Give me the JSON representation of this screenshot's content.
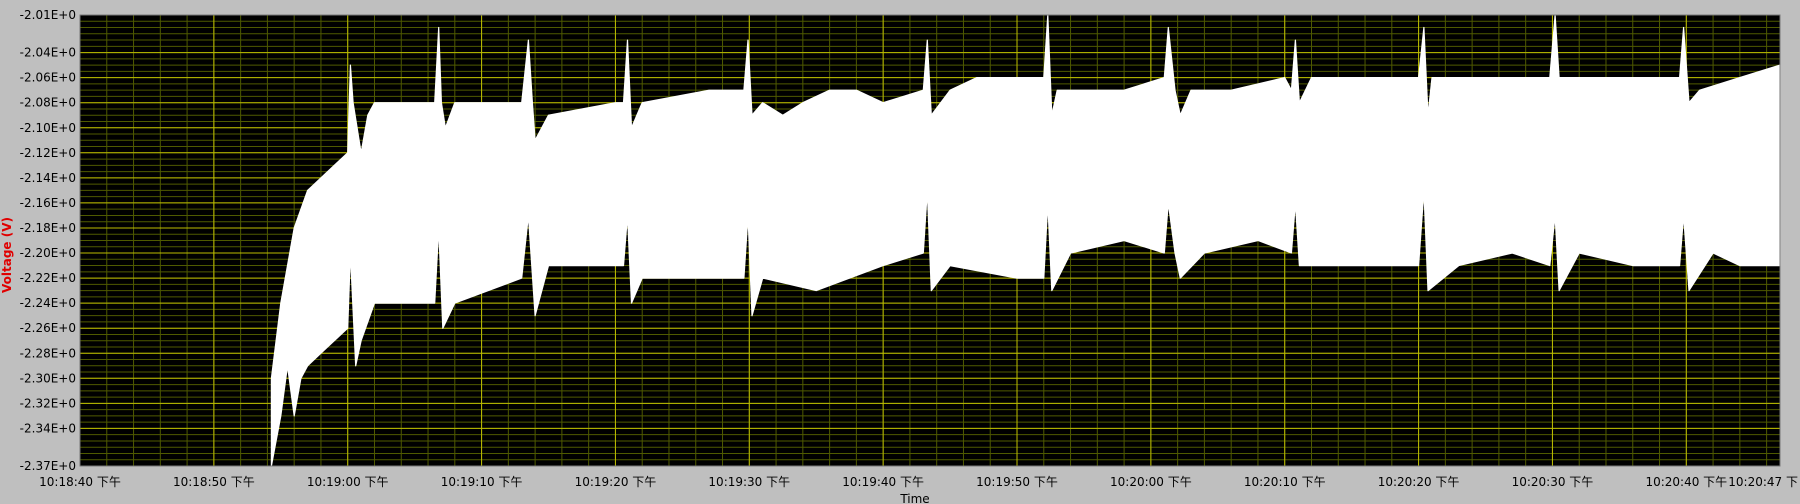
{
  "chart_data": {
    "type": "line",
    "title": "",
    "xlabel": "Time",
    "ylabel": "Voltage (V)",
    "ylim": [
      -2.37,
      -2.01
    ],
    "xlim_seconds": [
      0,
      127
    ],
    "grid": true,
    "background": "#000000",
    "colors": {
      "plot_bg": "#000000",
      "major_grid": "#bdbd00",
      "minor_grid": "#4f5a00",
      "trace": "#ffffff",
      "panel": "#bfbfbf",
      "ylabel": "#e00000"
    },
    "y_ticks": [
      {
        "value": -2.01,
        "label": "-2.01E+0"
      },
      {
        "value": -2.04,
        "label": "-2.04E+0"
      },
      {
        "value": -2.06,
        "label": "-2.06E+0"
      },
      {
        "value": -2.08,
        "label": "-2.08E+0"
      },
      {
        "value": -2.1,
        "label": "-2.10E+0"
      },
      {
        "value": -2.12,
        "label": "-2.12E+0"
      },
      {
        "value": -2.14,
        "label": "-2.14E+0"
      },
      {
        "value": -2.16,
        "label": "-2.16E+0"
      },
      {
        "value": -2.18,
        "label": "-2.18E+0"
      },
      {
        "value": -2.2,
        "label": "-2.20E+0"
      },
      {
        "value": -2.22,
        "label": "-2.22E+0"
      },
      {
        "value": -2.24,
        "label": "-2.24E+0"
      },
      {
        "value": -2.26,
        "label": "-2.26E+0"
      },
      {
        "value": -2.28,
        "label": "-2.28E+0"
      },
      {
        "value": -2.3,
        "label": "-2.30E+0"
      },
      {
        "value": -2.32,
        "label": "-2.32E+0"
      },
      {
        "value": -2.34,
        "label": "-2.34E+0"
      },
      {
        "value": -2.37,
        "label": "-2.37E+0"
      }
    ],
    "x_ticks": [
      {
        "value": 0,
        "label": "10:18:40 下午"
      },
      {
        "value": 10,
        "label": "10:18:50 下午"
      },
      {
        "value": 20,
        "label": "10:19:00 下午"
      },
      {
        "value": 30,
        "label": "10:19:10 下午"
      },
      {
        "value": 40,
        "label": "10:19:20 下午"
      },
      {
        "value": 50,
        "label": "10:19:30 下午"
      },
      {
        "value": 60,
        "label": "10:19:40 下午"
      },
      {
        "value": 70,
        "label": "10:19:50 下午"
      },
      {
        "value": 80,
        "label": "10:20:00 下午"
      },
      {
        "value": 90,
        "label": "10:20:10 下午"
      },
      {
        "value": 100,
        "label": "10:20:20 下午"
      },
      {
        "value": 110,
        "label": "10:20:30 下午"
      },
      {
        "value": 120,
        "label": "10:20:40 下午"
      },
      {
        "value": 127,
        "label": "10:20:47 下"
      }
    ],
    "series": [
      {
        "values_upper": [
          [
            14.3,
            -2.3
          ],
          [
            15.0,
            -2.24
          ],
          [
            16.0,
            -2.18
          ],
          [
            17.0,
            -2.15
          ],
          [
            18.0,
            -2.14
          ],
          [
            19.0,
            -2.13
          ],
          [
            20.0,
            -2.12
          ],
          [
            20.2,
            -2.05
          ],
          [
            20.4,
            -2.08
          ],
          [
            21.0,
            -2.12
          ],
          [
            21.5,
            -2.09
          ],
          [
            22.0,
            -2.08
          ],
          [
            25.0,
            -2.08
          ],
          [
            26.5,
            -2.08
          ],
          [
            26.8,
            -2.02
          ],
          [
            27.0,
            -2.08
          ],
          [
            27.3,
            -2.1
          ],
          [
            28.0,
            -2.08
          ],
          [
            33.0,
            -2.08
          ],
          [
            33.5,
            -2.03
          ],
          [
            33.8,
            -2.08
          ],
          [
            34.0,
            -2.11
          ],
          [
            35.0,
            -2.09
          ],
          [
            40.0,
            -2.08
          ],
          [
            40.6,
            -2.08
          ],
          [
            40.9,
            -2.03
          ],
          [
            41.2,
            -2.1
          ],
          [
            42.0,
            -2.08
          ],
          [
            47.0,
            -2.07
          ],
          [
            49.6,
            -2.07
          ],
          [
            49.9,
            -2.03
          ],
          [
            50.2,
            -2.09
          ],
          [
            51.0,
            -2.08
          ],
          [
            52.5,
            -2.09
          ],
          [
            54.0,
            -2.08
          ],
          [
            56.0,
            -2.07
          ],
          [
            58.0,
            -2.07
          ],
          [
            60.0,
            -2.08
          ],
          [
            63.0,
            -2.07
          ],
          [
            63.3,
            -2.03
          ],
          [
            63.6,
            -2.09
          ],
          [
            65.0,
            -2.07
          ],
          [
            67.0,
            -2.06
          ],
          [
            70.0,
            -2.06
          ],
          [
            72.0,
            -2.06
          ],
          [
            72.3,
            -2.01
          ],
          [
            72.6,
            -2.09
          ],
          [
            73.0,
            -2.07
          ],
          [
            76.0,
            -2.07
          ],
          [
            78.0,
            -2.07
          ],
          [
            81.0,
            -2.06
          ],
          [
            81.3,
            -2.02
          ],
          [
            81.8,
            -2.07
          ],
          [
            82.2,
            -2.09
          ],
          [
            83.0,
            -2.07
          ],
          [
            86.0,
            -2.07
          ],
          [
            90.0,
            -2.06
          ],
          [
            90.5,
            -2.07
          ],
          [
            90.8,
            -2.03
          ],
          [
            91.1,
            -2.08
          ],
          [
            92.0,
            -2.06
          ],
          [
            97.0,
            -2.06
          ],
          [
            100.0,
            -2.06
          ],
          [
            100.4,
            -2.02
          ],
          [
            100.7,
            -2.09
          ],
          [
            101.0,
            -2.06
          ],
          [
            104.0,
            -2.06
          ],
          [
            107.0,
            -2.06
          ],
          [
            109.8,
            -2.06
          ],
          [
            110.2,
            -2.01
          ],
          [
            110.5,
            -2.06
          ],
          [
            112.0,
            -2.06
          ],
          [
            116.0,
            -2.06
          ],
          [
            119.5,
            -2.06
          ],
          [
            119.8,
            -2.02
          ],
          [
            120.2,
            -2.08
          ],
          [
            121.0,
            -2.07
          ],
          [
            124.0,
            -2.06
          ],
          [
            127.0,
            -2.05
          ]
        ],
        "values_lower": [
          [
            14.3,
            -2.37
          ],
          [
            15.0,
            -2.33
          ],
          [
            15.5,
            -2.29
          ],
          [
            16.0,
            -2.33
          ],
          [
            16.5,
            -2.3
          ],
          [
            17.0,
            -2.29
          ],
          [
            18.0,
            -2.28
          ],
          [
            19.0,
            -2.27
          ],
          [
            20.0,
            -2.26
          ],
          [
            20.2,
            -2.2
          ],
          [
            20.6,
            -2.29
          ],
          [
            21.0,
            -2.27
          ],
          [
            22.0,
            -2.24
          ],
          [
            25.0,
            -2.24
          ],
          [
            26.5,
            -2.24
          ],
          [
            26.8,
            -2.18
          ],
          [
            27.1,
            -2.26
          ],
          [
            28.0,
            -2.24
          ],
          [
            33.0,
            -2.22
          ],
          [
            33.5,
            -2.17
          ],
          [
            34.0,
            -2.25
          ],
          [
            35.0,
            -2.21
          ],
          [
            40.0,
            -2.21
          ],
          [
            40.6,
            -2.21
          ],
          [
            40.9,
            -2.17
          ],
          [
            41.2,
            -2.24
          ],
          [
            42.0,
            -2.22
          ],
          [
            47.0,
            -2.22
          ],
          [
            49.6,
            -2.22
          ],
          [
            49.9,
            -2.17
          ],
          [
            50.2,
            -2.25
          ],
          [
            51.0,
            -2.22
          ],
          [
            55.0,
            -2.23
          ],
          [
            60.0,
            -2.21
          ],
          [
            63.0,
            -2.2
          ],
          [
            63.3,
            -2.15
          ],
          [
            63.6,
            -2.23
          ],
          [
            65.0,
            -2.21
          ],
          [
            70.0,
            -2.22
          ],
          [
            72.0,
            -2.22
          ],
          [
            72.3,
            -2.16
          ],
          [
            72.6,
            -2.23
          ],
          [
            74.0,
            -2.2
          ],
          [
            78.0,
            -2.19
          ],
          [
            81.0,
            -2.2
          ],
          [
            81.3,
            -2.16
          ],
          [
            81.8,
            -2.2
          ],
          [
            82.2,
            -2.22
          ],
          [
            84.0,
            -2.2
          ],
          [
            88.0,
            -2.19
          ],
          [
            90.5,
            -2.2
          ],
          [
            90.8,
            -2.16
          ],
          [
            91.1,
            -2.21
          ],
          [
            93.0,
            -2.21
          ],
          [
            97.0,
            -2.21
          ],
          [
            100.0,
            -2.21
          ],
          [
            100.4,
            -2.15
          ],
          [
            100.7,
            -2.23
          ],
          [
            103.0,
            -2.21
          ],
          [
            107.0,
            -2.2
          ],
          [
            109.8,
            -2.21
          ],
          [
            110.2,
            -2.17
          ],
          [
            110.5,
            -2.23
          ],
          [
            112.0,
            -2.2
          ],
          [
            116.0,
            -2.21
          ],
          [
            119.5,
            -2.21
          ],
          [
            119.8,
            -2.17
          ],
          [
            120.2,
            -2.23
          ],
          [
            122.0,
            -2.2
          ],
          [
            124.0,
            -2.21
          ],
          [
            127.0,
            -2.21
          ]
        ]
      }
    ]
  }
}
